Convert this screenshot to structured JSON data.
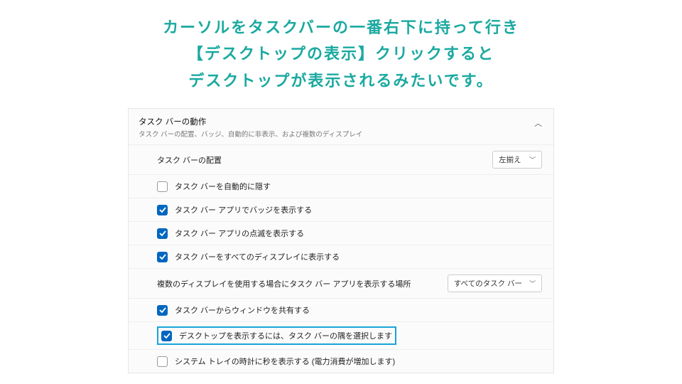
{
  "caption": {
    "line1": "カーソルをタスクバーの一番右下に持って行き",
    "line2": "【デスクトップの表示】クリックすると",
    "line3": "デスクトップが表示されるみたいです。"
  },
  "panel": {
    "title": "タスク バーの動作",
    "subtitle": "タスク バーの配置、バッジ、自動的に非表示、および複数のディスプレイ"
  },
  "rows": {
    "alignment": {
      "label": "タスク バーの配置",
      "value": "左揃え"
    },
    "autohide": {
      "label": "タスク バーを自動的に隠す",
      "checked": false
    },
    "badges": {
      "label": "タスク バー アプリでバッジを表示する",
      "checked": true
    },
    "flashing": {
      "label": "タスク バー アプリの点滅を表示する",
      "checked": true
    },
    "alldisplays": {
      "label": "タスク バーをすべてのディスプレイに表示する",
      "checked": true
    },
    "multidisplay": {
      "label": "複数のディスプレイを使用する場合にタスク バー アプリを表示する場所",
      "value": "すべてのタスク バー"
    },
    "sharewindow": {
      "label": "タスク バーからウィンドウを共有する",
      "checked": true
    },
    "showdesktop": {
      "label": "デスクトップを表示するには、タスク バーの隅を選択します",
      "checked": true
    },
    "seconds": {
      "label": "システム トレイの時計に秒を表示する (電力消費が増加します)",
      "checked": false
    }
  }
}
